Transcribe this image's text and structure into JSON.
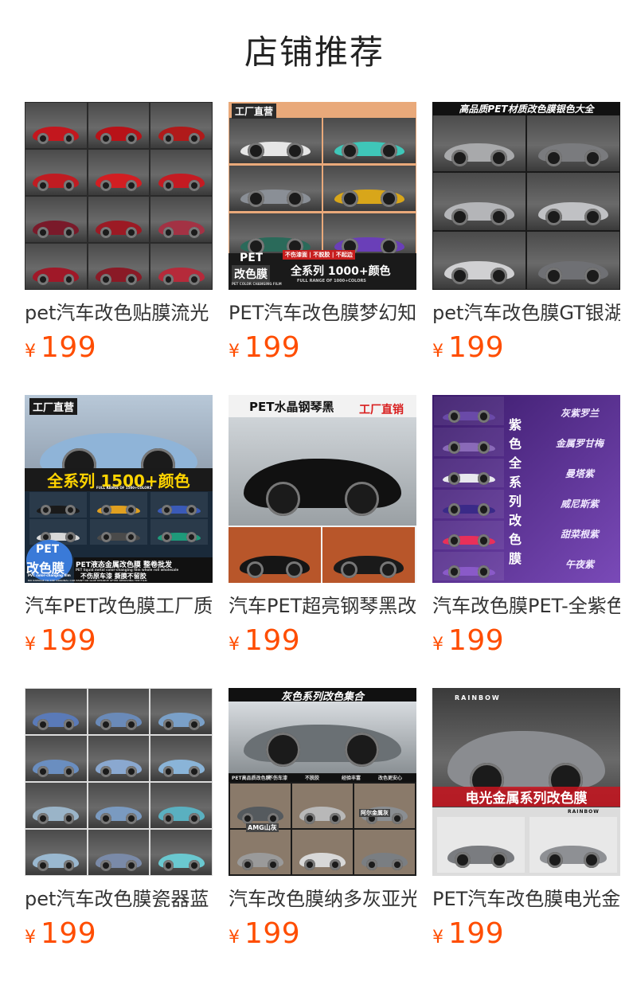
{
  "page": {
    "title": "店铺推荐"
  },
  "products": [
    {
      "name": "pet汽车改色贴膜流光",
      "currency": "¥",
      "price": "199",
      "image": {
        "type": "collage",
        "cols": 3,
        "rows": 4,
        "colors": [
          "#c3171e",
          "#b81218",
          "#b01a1a",
          "#c01c22",
          "#d21e22",
          "#c41b22",
          "#7a1a2a",
          "#9c1a24",
          "#a33244",
          "#a01828",
          "#8a1a26",
          "#b52a3a"
        ],
        "bg": "#2a2a2a"
      }
    },
    {
      "name": "PET汽车改色膜梦幻知",
      "currency": "¥",
      "price": "199",
      "image": {
        "type": "collage",
        "cols": 2,
        "rows": 3,
        "colors": [
          "#e6e6e6",
          "#3fc6b8",
          "#8a8f96",
          "#d8a61a",
          "#2a6a5a",
          "#6a3fb8"
        ],
        "bg": "#e9a97a",
        "badges": [
          "工厂直营",
          "FACTORY DIRECT SALES",
          "PET",
          "改色膜",
          "全系列 1000+颜色",
          "不伤漆面 | 不脱胶 | 不起边",
          "FULL RANGE OF 1000+COLORS",
          "PET COLOR CHANGING FILM"
        ]
      }
    },
    {
      "name": "pet汽车改色膜GT银湖",
      "currency": "¥",
      "price": "199",
      "image": {
        "type": "collage",
        "cols": 2,
        "rows": 3,
        "colors": [
          "#a8a9ab",
          "#7a7b7e",
          "#b4b5b8",
          "#c0c1c4",
          "#d0d0d2",
          "#6f7074"
        ],
        "bg": "#1a1a1a",
        "badges": [
          "高品质PET材质改色膜银色大全"
        ]
      }
    },
    {
      "name": "汽车PET改色膜工厂质",
      "currency": "¥",
      "price": "199",
      "image": {
        "type": "hero",
        "main": "#8fb4d8",
        "bg": "#1a2a3a",
        "minis": [
          "#1a1a1a",
          "#e0a020",
          "#3a5ab8",
          "#d8d8d8",
          "#4a4a4a",
          "#1e9a7a"
        ],
        "badges": [
          "工厂直营",
          "FACTORY DIRECT SALES",
          "全系列 1500+颜色",
          "FULL RANGE OF 1500+COLORS",
          "PET",
          "改色膜",
          "PET液态金属改色膜 整卷批发",
          "PET liquid metal color-changing film whole roll wholesale",
          "不伤原车漆 撕膜不留胶",
          "PVC color-changing film",
          "NO DAMAGE TO THE ORIGINAL CAR PAINT NO GLUE RESIDUE AFTER REMOVING THE FILM"
        ]
      }
    },
    {
      "name": "汽车PET超亮钢琴黑改",
      "currency": "¥",
      "price": "199",
      "image": {
        "type": "hero2",
        "main": "#111111",
        "bg": "#f2f2f2",
        "minis": [
          "#151515",
          "#1a1a1a"
        ],
        "badges": [
          "PET水晶钢琴黑",
          "工厂直销"
        ]
      }
    },
    {
      "name": "汽车改色膜PET-全紫色",
      "currency": "¥",
      "price": "199",
      "image": {
        "type": "list",
        "bg": "#4a2a7a",
        "rows": [
          "#6a4aa8",
          "#8a6ab8",
          "#e8e8ee",
          "#3a2a88",
          "#e8305a",
          "#8a5ac8"
        ],
        "vertical": [
          "紫",
          "色",
          "全",
          "系",
          "列",
          "改",
          "色",
          "膜"
        ],
        "labels": [
          "灰紫罗兰",
          "金属罗甘梅",
          "曼塔紫",
          "威尼斯紫",
          "甜菜根紫",
          "午夜紫"
        ]
      }
    },
    {
      "name": "pet汽车改色膜瓷器蓝",
      "currency": "¥",
      "price": "199",
      "image": {
        "type": "collage",
        "cols": 3,
        "rows": 4,
        "colors": [
          "#5a7ab8",
          "#6a8ab8",
          "#7aa0c8",
          "#6a8ec0",
          "#8aa8d0",
          "#8ab4d8",
          "#9ab4c8",
          "#7a9ac0",
          "#5ab0c0",
          "#9ab8d0",
          "#7a8aa8",
          "#6ac8d0"
        ],
        "bg": "#dcdcdc"
      }
    },
    {
      "name": "汽车改色膜纳多灰亚光",
      "currency": "¥",
      "price": "199",
      "image": {
        "type": "hero3",
        "main": "#6a7074",
        "bg": "#1a1a1a",
        "minis": [
          "#555a5e",
          "#b8b8b8",
          "#8a8e92",
          "#9a9a9a",
          "#d8d8d8",
          "#7a7e82"
        ],
        "badges": [
          "灰色系列改色集合",
          "PET高品质改色膜",
          "不伤车漆",
          "不脱胶",
          "经验丰富",
          "改色更安心",
          "AMG山灰",
          "阿尔金属灰"
        ]
      }
    },
    {
      "name": "PET汽车改色膜电光金",
      "currency": "¥",
      "price": "199",
      "image": {
        "type": "hero4",
        "main": "#8a8c90",
        "bg": "#222222",
        "minis": [
          "#7a7c80",
          "#8e9094"
        ],
        "badges": [
          "RAINBOW",
          "电光金属系列改色膜",
          "RAINBOW"
        ]
      }
    }
  ]
}
